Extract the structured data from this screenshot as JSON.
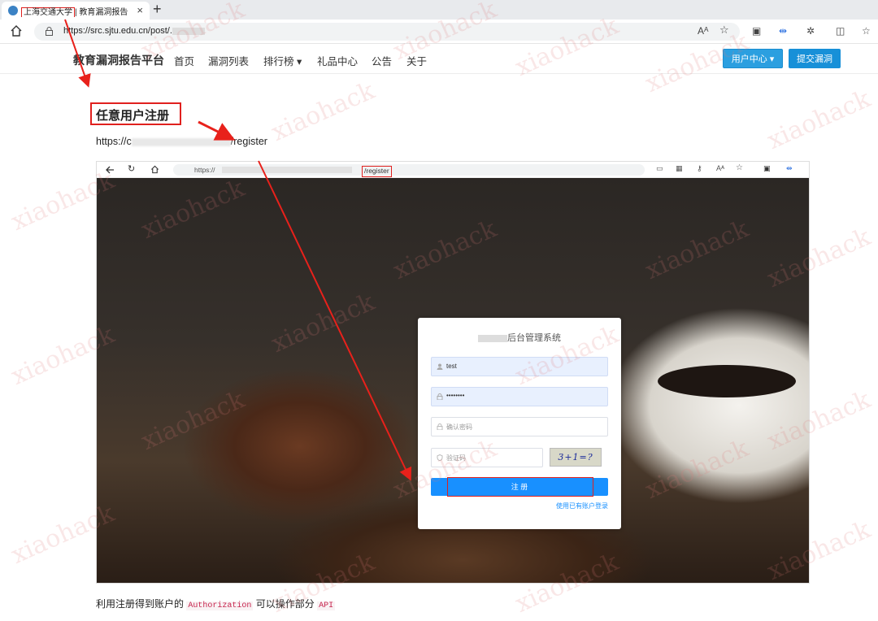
{
  "browser": {
    "tab_title_boxed": "上海交通大学",
    "tab_title_rest": "| 教育漏洞报告",
    "tab_close": "×",
    "new_tab": "+",
    "url": "https://src.sjtu.edu.cn/post/."
  },
  "site": {
    "brand": "教育漏洞报告平台",
    "nav": [
      "首页",
      "漏洞列表",
      "排行榜 ▾",
      "礼品中心",
      "公告",
      "关于"
    ],
    "user_center": "用户中心 ▾",
    "submit": "提交漏洞"
  },
  "article": {
    "heading": "任意用户注册",
    "url_prefix": "https://c",
    "url_suffix": "/register",
    "footer_text_1": "利用注册得到账户的",
    "footer_code_1": "Authorization",
    "footer_text_2": "可以操作部分",
    "footer_code_2": "API"
  },
  "screenshot": {
    "url_prefix": "https://",
    "url_boxed": "/register",
    "card_title": "后台管理系统",
    "username": "test",
    "password": "••••••••",
    "confirm_placeholder": "确认密码",
    "captcha_placeholder": "验证码",
    "captcha_text": "3+1=?",
    "register_button": "注 册",
    "login_link": "使用已有账户登录"
  },
  "watermark": "xiaohack"
}
